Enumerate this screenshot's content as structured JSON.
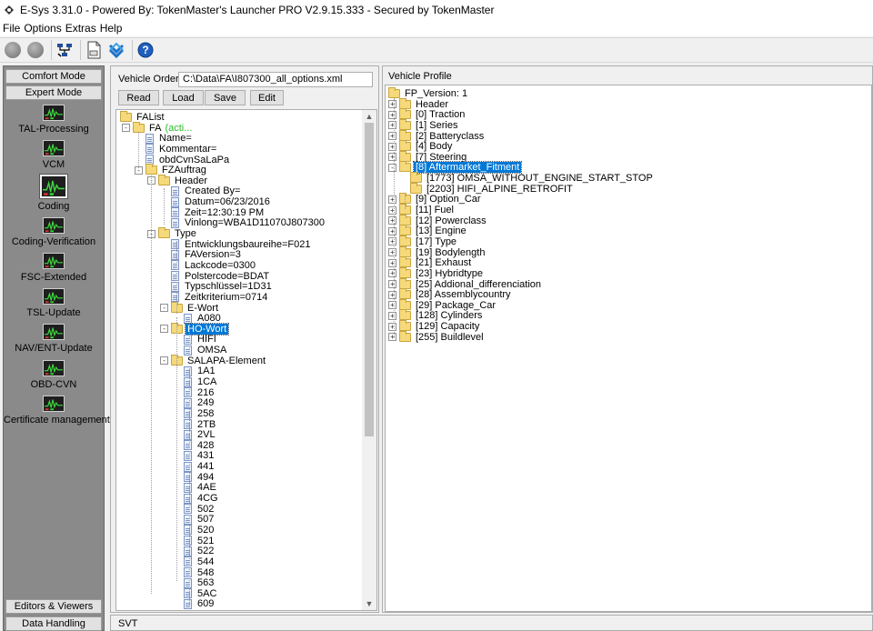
{
  "window": {
    "title": "E-Sys 3.31.0 - Powered By: TokenMaster's Launcher PRO V2.9.15.333 - Secured by TokenMaster"
  },
  "menu": [
    "File",
    "Options",
    "Extras",
    "Help"
  ],
  "toolbar": {
    "icons": [
      "disconnect-icon",
      "connect-icon",
      "network-icon",
      "document-icon",
      "bmw-logo-icon",
      "help-icon"
    ],
    "help_glyph": "?"
  },
  "leftnav": {
    "top_modes": [
      "Comfort Mode",
      "Expert Mode"
    ],
    "items": [
      "TAL-Processing",
      "VCM",
      "Coding",
      "Coding-Verification",
      "FSC-Extended",
      "TSL-Update",
      "NAV/ENT-Update",
      "OBD-CVN",
      "Certificate management"
    ],
    "selected": "Coding",
    "bottom_modes": [
      "Editors & Viewers",
      "Data Handling"
    ]
  },
  "vehicle_order": {
    "label": "Vehicle Order",
    "path": "C:\\Data\\FA\\I807300_all_options.xml",
    "buttons": [
      "Read",
      "Load",
      "Save",
      "Edit"
    ],
    "tree": [
      {
        "label": "FAList",
        "icon": "folder",
        "depth": 0
      },
      {
        "label": "FA",
        "icon": "folder",
        "depth": 1,
        "exp": "-",
        "suffix": "(acti..."
      },
      {
        "label": "Name=",
        "icon": "doc",
        "depth": 2
      },
      {
        "label": "Kommentar=",
        "icon": "doc",
        "depth": 2
      },
      {
        "label": "obdCvnSaLaPa",
        "icon": "doc",
        "depth": 2
      },
      {
        "label": "FZAuftrag",
        "icon": "folder",
        "depth": 2,
        "exp": "-"
      },
      {
        "label": "Header",
        "icon": "folder",
        "depth": 3,
        "exp": "-"
      },
      {
        "label": "Created By=",
        "icon": "doc",
        "depth": 4
      },
      {
        "label": "Datum=06/23/2016",
        "icon": "doc",
        "depth": 4
      },
      {
        "label": "Zeit=12:30:19 PM",
        "icon": "doc",
        "depth": 4
      },
      {
        "label": "Vinlong=WBA1D11070J807300",
        "icon": "doc",
        "depth": 4
      },
      {
        "label": "Type",
        "icon": "folder",
        "depth": 3,
        "exp": "-"
      },
      {
        "label": "Entwicklungsbaureihe=F021",
        "icon": "doc",
        "depth": 4
      },
      {
        "label": "FAVersion=3",
        "icon": "doc",
        "depth": 4
      },
      {
        "label": "Lackcode=0300",
        "icon": "doc",
        "depth": 4
      },
      {
        "label": "Polstercode=BDAT",
        "icon": "doc",
        "depth": 4
      },
      {
        "label": "Typschlüssel=1D31",
        "icon": "doc",
        "depth": 4
      },
      {
        "label": "Zeitkriterium=0714",
        "icon": "doc",
        "depth": 4
      },
      {
        "label": "E-Wort",
        "icon": "folder",
        "depth": 4,
        "exp": "-"
      },
      {
        "label": "A080",
        "icon": "doc",
        "depth": 5
      },
      {
        "label": "HO-Wort",
        "icon": "folder",
        "depth": 4,
        "exp": "-",
        "selected": true
      },
      {
        "label": "HIFI",
        "icon": "doc",
        "depth": 5
      },
      {
        "label": "OMSA",
        "icon": "doc",
        "depth": 5
      },
      {
        "label": "SALAPA-Element",
        "icon": "folder",
        "depth": 4,
        "exp": "-"
      },
      {
        "label": "1A1",
        "icon": "doc",
        "depth": 5
      },
      {
        "label": "1CA",
        "icon": "doc",
        "depth": 5
      },
      {
        "label": "216",
        "icon": "doc",
        "depth": 5
      },
      {
        "label": "249",
        "icon": "doc",
        "depth": 5
      },
      {
        "label": "258",
        "icon": "doc",
        "depth": 5
      },
      {
        "label": "2TB",
        "icon": "doc",
        "depth": 5
      },
      {
        "label": "2VL",
        "icon": "doc",
        "depth": 5
      },
      {
        "label": "428",
        "icon": "doc",
        "depth": 5
      },
      {
        "label": "431",
        "icon": "doc",
        "depth": 5
      },
      {
        "label": "441",
        "icon": "doc",
        "depth": 5
      },
      {
        "label": "494",
        "icon": "doc",
        "depth": 5
      },
      {
        "label": "4AE",
        "icon": "doc",
        "depth": 5
      },
      {
        "label": "4CG",
        "icon": "doc",
        "depth": 5
      },
      {
        "label": "502",
        "icon": "doc",
        "depth": 5
      },
      {
        "label": "507",
        "icon": "doc",
        "depth": 5
      },
      {
        "label": "520",
        "icon": "doc",
        "depth": 5
      },
      {
        "label": "521",
        "icon": "doc",
        "depth": 5
      },
      {
        "label": "522",
        "icon": "doc",
        "depth": 5
      },
      {
        "label": "544",
        "icon": "doc",
        "depth": 5
      },
      {
        "label": "548",
        "icon": "doc",
        "depth": 5
      },
      {
        "label": "563",
        "icon": "doc",
        "depth": 5
      },
      {
        "label": "5AC",
        "icon": "doc",
        "depth": 5
      },
      {
        "label": "609",
        "icon": "doc",
        "depth": 5
      }
    ]
  },
  "vehicle_profile": {
    "title": "Vehicle Profile",
    "tree": [
      {
        "label": "FP_Version: 1",
        "icon": "folder",
        "depth": 0
      },
      {
        "label": "Header",
        "icon": "folder",
        "depth": 1,
        "exp": "+"
      },
      {
        "label": "[0] Traction",
        "icon": "folder",
        "depth": 1,
        "exp": "+"
      },
      {
        "label": "[1] Series",
        "icon": "folder",
        "depth": 1,
        "exp": "+"
      },
      {
        "label": "[2] Batteryclass",
        "icon": "folder",
        "depth": 1,
        "exp": "+"
      },
      {
        "label": "[4] Body",
        "icon": "folder",
        "depth": 1,
        "exp": "+"
      },
      {
        "label": "[7] Steering",
        "icon": "folder",
        "depth": 1,
        "exp": "+"
      },
      {
        "label": "[8] Aftermarket_Fitment",
        "icon": "folder",
        "depth": 1,
        "exp": "-",
        "selected": true
      },
      {
        "label": "[1773] OMSA_WITHOUT_ENGINE_START_STOP",
        "icon": "folder",
        "depth": 2
      },
      {
        "label": "[2203] HIFI_ALPINE_RETROFIT",
        "icon": "folder",
        "depth": 2
      },
      {
        "label": "[9] Option_Car",
        "icon": "folder",
        "depth": 1,
        "exp": "+"
      },
      {
        "label": "[11] Fuel",
        "icon": "folder",
        "depth": 1,
        "exp": "+"
      },
      {
        "label": "[12] Powerclass",
        "icon": "folder",
        "depth": 1,
        "exp": "+"
      },
      {
        "label": "[13] Engine",
        "icon": "folder",
        "depth": 1,
        "exp": "+"
      },
      {
        "label": "[17] Type",
        "icon": "folder",
        "depth": 1,
        "exp": "+"
      },
      {
        "label": "[19] Bodylength",
        "icon": "folder",
        "depth": 1,
        "exp": "+"
      },
      {
        "label": "[21] Exhaust",
        "icon": "folder",
        "depth": 1,
        "exp": "+"
      },
      {
        "label": "[23] Hybridtype",
        "icon": "folder",
        "depth": 1,
        "exp": "+"
      },
      {
        "label": "[25] Addional_differenciation",
        "icon": "folder",
        "depth": 1,
        "exp": "+"
      },
      {
        "label": "[28] Assemblycountry",
        "icon": "folder",
        "depth": 1,
        "exp": "+"
      },
      {
        "label": "[29] Package_Car",
        "icon": "folder",
        "depth": 1,
        "exp": "+"
      },
      {
        "label": "[128] Cylinders",
        "icon": "folder",
        "depth": 1,
        "exp": "+"
      },
      {
        "label": "[129] Capacity",
        "icon": "folder",
        "depth": 1,
        "exp": "+"
      },
      {
        "label": "[255] Buildlevel",
        "icon": "folder",
        "depth": 1,
        "exp": "+"
      }
    ]
  },
  "svt": {
    "label": "SVT"
  },
  "colors": {
    "selection": "#0078d7",
    "active_text": "#28c028",
    "folder": "#f5d97a",
    "nav_background": "#8a8a8a"
  }
}
